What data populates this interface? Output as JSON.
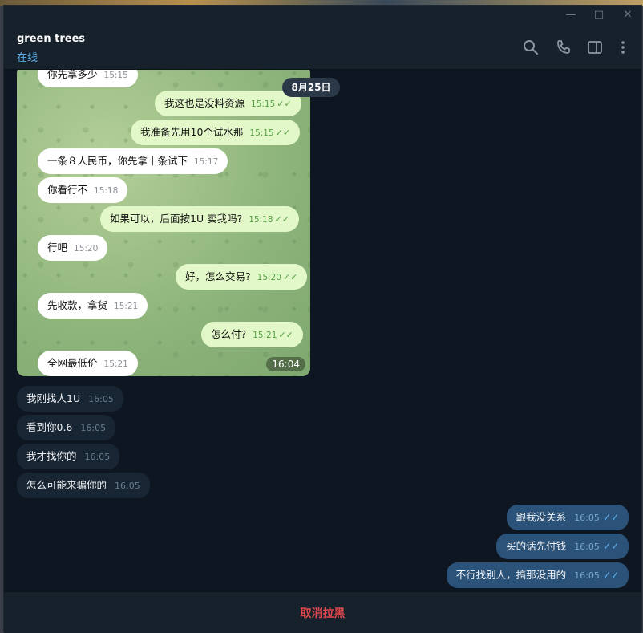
{
  "window": {
    "controls": [
      "minimize-icon",
      "maximize-icon",
      "close-icon"
    ]
  },
  "header": {
    "name": "green trees",
    "status": "在线",
    "icons": [
      "search-icon",
      "phone-icon",
      "sidebar-toggle-icon",
      "more-vertical-icon"
    ]
  },
  "screenshot": {
    "date": "8月25日",
    "image_time": "16:04",
    "messages": [
      {
        "dir": "in",
        "text": "你先拿多少",
        "time": "15:15"
      },
      {
        "dir": "out",
        "text": "我这也是没料资源",
        "time": "15:15"
      },
      {
        "dir": "out",
        "text": "我准备先用10个试水那",
        "time": "15:15"
      },
      {
        "dir": "in",
        "text": "一条８人民币，你先拿十条试下",
        "time": "15:17"
      },
      {
        "dir": "in",
        "text": "你看行不",
        "time": "15:18"
      },
      {
        "dir": "out",
        "text": "如果可以，后面按1U 卖我吗?",
        "time": "15:18"
      },
      {
        "dir": "in",
        "text": "行吧",
        "time": "15:20"
      },
      {
        "dir": "out",
        "text": "好，怎么交易?",
        "time": "15:20"
      },
      {
        "dir": "in",
        "text": "先收款，拿货",
        "time": "15:21"
      },
      {
        "dir": "out",
        "text": "怎么付?",
        "time": "15:21"
      },
      {
        "dir": "in",
        "text": "全网最低价",
        "time": "15:21"
      }
    ]
  },
  "messages": [
    {
      "dir": "in",
      "text": "我刚找人1U",
      "time": "16:05"
    },
    {
      "dir": "in",
      "text": "看到你0.6",
      "time": "16:05"
    },
    {
      "dir": "in",
      "text": "我才找你的",
      "time": "16:05"
    },
    {
      "dir": "in",
      "text": "怎么可能来骗你的",
      "time": "16:05"
    },
    {
      "dir": "out",
      "text": "跟我没关系",
      "time": "16:05"
    },
    {
      "dir": "out",
      "text": "买的话先付钱",
      "time": "16:05"
    },
    {
      "dir": "out",
      "text": "不行找别人，搞那没用的",
      "time": "16:05"
    }
  ],
  "footer": {
    "unblock_label": "取消拉黑"
  },
  "colors": {
    "accent": "#5eaeeb",
    "danger": "#e0484e",
    "out_bubble": "#2b5278",
    "in_bubble": "#182533"
  }
}
